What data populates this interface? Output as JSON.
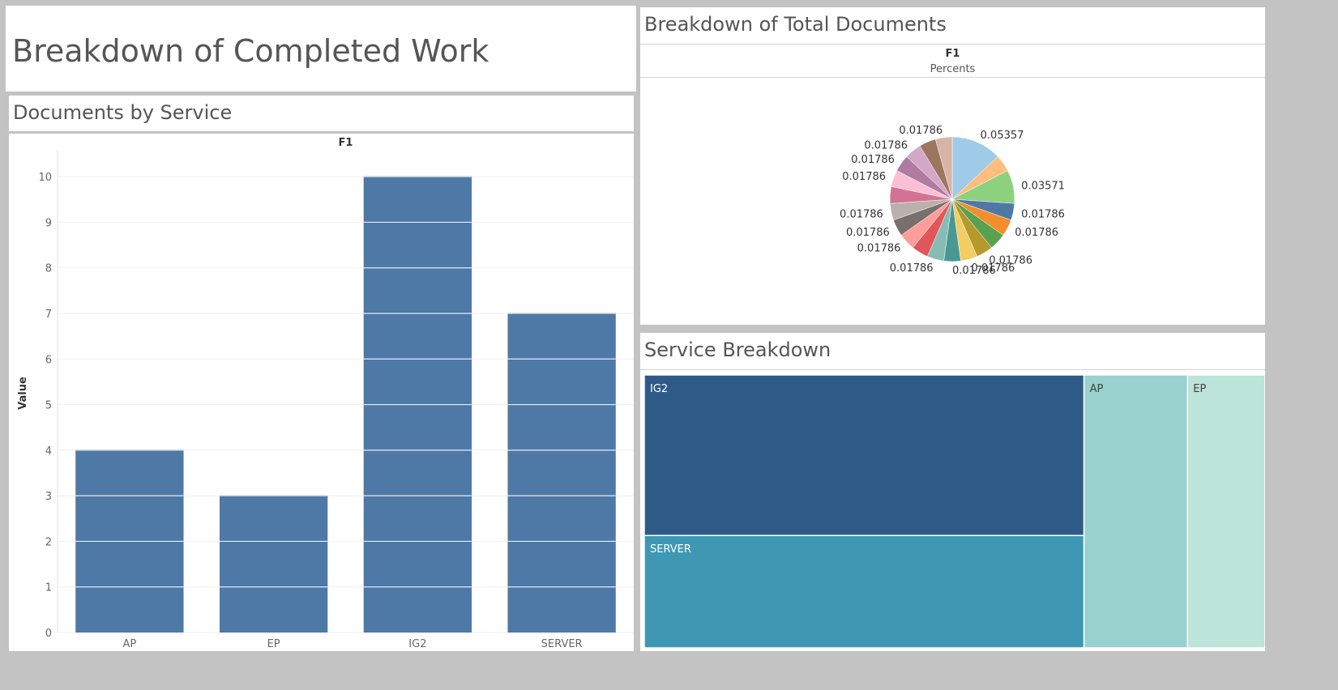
{
  "dashboard": {
    "title": "Breakdown of Completed Work"
  },
  "bar_sheet": {
    "title": "Documents by Service",
    "header": "F1"
  },
  "pie_sheet": {
    "title": "Breakdown of Total Documents",
    "header": "F1",
    "subheader": "Percents"
  },
  "treemap_sheet": {
    "title": "Service Breakdown"
  },
  "chart_data": [
    {
      "type": "bar",
      "title": "Documents by Service",
      "categories": [
        "AP",
        "EP",
        "IG2",
        "SERVER"
      ],
      "values": [
        4,
        3,
        10,
        7
      ],
      "xlabel": "",
      "ylabel": "Value",
      "ylim": [
        0,
        10.5
      ],
      "yticks": [
        0,
        1,
        2,
        3,
        4,
        5,
        6,
        7,
        8,
        9,
        10
      ],
      "color": "#4e79a7",
      "grid": true,
      "stacked_unit_segments": true
    },
    {
      "type": "pie",
      "title": "Breakdown of Total Documents",
      "slices": [
        {
          "value": 0.05357,
          "color": "#a0cbe8"
        },
        {
          "value": 0.01786,
          "color": "#ffbe7d"
        },
        {
          "value": 0.03571,
          "color": "#8cd17d"
        },
        {
          "value": 0.01786,
          "color": "#4e79a7"
        },
        {
          "value": 0.01786,
          "color": "#f28e2b"
        },
        {
          "value": 0.01786,
          "color": "#59a14f"
        },
        {
          "value": 0.01786,
          "color": "#b6992d"
        },
        {
          "value": 0.01786,
          "color": "#f1ce63"
        },
        {
          "value": 0.01786,
          "color": "#499894"
        },
        {
          "value": 0.01786,
          "color": "#86bcb6"
        },
        {
          "value": 0.01786,
          "color": "#e15759"
        },
        {
          "value": 0.01786,
          "color": "#ff9d9a"
        },
        {
          "value": 0.01786,
          "color": "#79706e"
        },
        {
          "value": 0.01786,
          "color": "#bab0ac"
        },
        {
          "value": 0.01786,
          "color": "#d37295"
        },
        {
          "value": 0.01786,
          "color": "#fabfd2"
        },
        {
          "value": 0.01786,
          "color": "#b07aa1"
        },
        {
          "value": 0.01786,
          "color": "#d4a6c8"
        },
        {
          "value": 0.01786,
          "color": "#9d7660"
        },
        {
          "value": 0.01786,
          "color": "#d7b5a6"
        }
      ],
      "labels": [
        {
          "text": "0.05357",
          "slice": 0
        },
        {
          "text": "0.03571",
          "slice": 2
        },
        {
          "text": "0.01786",
          "slice": 3
        },
        {
          "text": "0.01786",
          "slice": 4
        },
        {
          "text": "0.01786",
          "slice": 6
        },
        {
          "text": "0.01786",
          "slice": 7
        },
        {
          "text": "0.01786",
          "slice": 8
        },
        {
          "text": "0.01786",
          "slice": 9
        },
        {
          "text": "0.01786",
          "slice": 11
        },
        {
          "text": "0.01786",
          "slice": 12
        },
        {
          "text": "0.01786",
          "slice": 13
        },
        {
          "text": "0.01786",
          "slice": 15
        },
        {
          "text": "0.01786",
          "slice": 16
        },
        {
          "text": "0.01786",
          "slice": 17
        },
        {
          "text": "0.01786",
          "slice": 19
        }
      ]
    },
    {
      "type": "treemap",
      "title": "Service Breakdown",
      "items": [
        {
          "label": "IG2",
          "value": 10,
          "color": "#2e5a87"
        },
        {
          "label": "SERVER",
          "value": 7,
          "color": "#3e98b3"
        },
        {
          "label": "AP",
          "value": 4,
          "color": "#99d1cf"
        },
        {
          "label": "EP",
          "value": 3,
          "color": "#bce4d8"
        }
      ]
    }
  ]
}
